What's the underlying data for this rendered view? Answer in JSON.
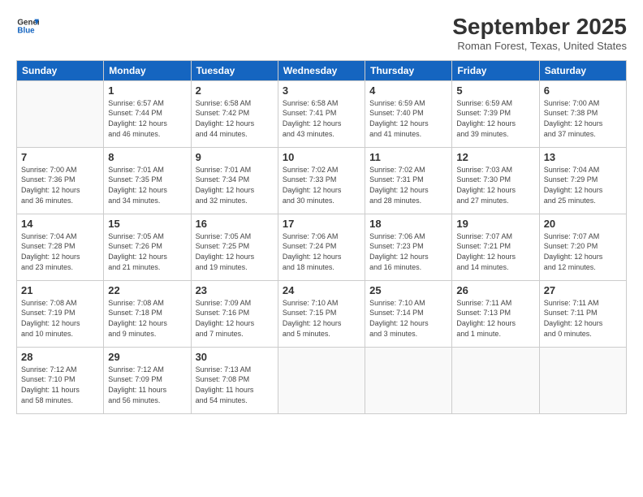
{
  "logo": {
    "line1": "General",
    "line2": "Blue"
  },
  "title": "September 2025",
  "subtitle": "Roman Forest, Texas, United States",
  "headers": [
    "Sunday",
    "Monday",
    "Tuesday",
    "Wednesday",
    "Thursday",
    "Friday",
    "Saturday"
  ],
  "weeks": [
    [
      {
        "day": "",
        "info": ""
      },
      {
        "day": "1",
        "info": "Sunrise: 6:57 AM\nSunset: 7:44 PM\nDaylight: 12 hours\nand 46 minutes."
      },
      {
        "day": "2",
        "info": "Sunrise: 6:58 AM\nSunset: 7:42 PM\nDaylight: 12 hours\nand 44 minutes."
      },
      {
        "day": "3",
        "info": "Sunrise: 6:58 AM\nSunset: 7:41 PM\nDaylight: 12 hours\nand 43 minutes."
      },
      {
        "day": "4",
        "info": "Sunrise: 6:59 AM\nSunset: 7:40 PM\nDaylight: 12 hours\nand 41 minutes."
      },
      {
        "day": "5",
        "info": "Sunrise: 6:59 AM\nSunset: 7:39 PM\nDaylight: 12 hours\nand 39 minutes."
      },
      {
        "day": "6",
        "info": "Sunrise: 7:00 AM\nSunset: 7:38 PM\nDaylight: 12 hours\nand 37 minutes."
      }
    ],
    [
      {
        "day": "7",
        "info": "Sunrise: 7:00 AM\nSunset: 7:36 PM\nDaylight: 12 hours\nand 36 minutes."
      },
      {
        "day": "8",
        "info": "Sunrise: 7:01 AM\nSunset: 7:35 PM\nDaylight: 12 hours\nand 34 minutes."
      },
      {
        "day": "9",
        "info": "Sunrise: 7:01 AM\nSunset: 7:34 PM\nDaylight: 12 hours\nand 32 minutes."
      },
      {
        "day": "10",
        "info": "Sunrise: 7:02 AM\nSunset: 7:33 PM\nDaylight: 12 hours\nand 30 minutes."
      },
      {
        "day": "11",
        "info": "Sunrise: 7:02 AM\nSunset: 7:31 PM\nDaylight: 12 hours\nand 28 minutes."
      },
      {
        "day": "12",
        "info": "Sunrise: 7:03 AM\nSunset: 7:30 PM\nDaylight: 12 hours\nand 27 minutes."
      },
      {
        "day": "13",
        "info": "Sunrise: 7:04 AM\nSunset: 7:29 PM\nDaylight: 12 hours\nand 25 minutes."
      }
    ],
    [
      {
        "day": "14",
        "info": "Sunrise: 7:04 AM\nSunset: 7:28 PM\nDaylight: 12 hours\nand 23 minutes."
      },
      {
        "day": "15",
        "info": "Sunrise: 7:05 AM\nSunset: 7:26 PM\nDaylight: 12 hours\nand 21 minutes."
      },
      {
        "day": "16",
        "info": "Sunrise: 7:05 AM\nSunset: 7:25 PM\nDaylight: 12 hours\nand 19 minutes."
      },
      {
        "day": "17",
        "info": "Sunrise: 7:06 AM\nSunset: 7:24 PM\nDaylight: 12 hours\nand 18 minutes."
      },
      {
        "day": "18",
        "info": "Sunrise: 7:06 AM\nSunset: 7:23 PM\nDaylight: 12 hours\nand 16 minutes."
      },
      {
        "day": "19",
        "info": "Sunrise: 7:07 AM\nSunset: 7:21 PM\nDaylight: 12 hours\nand 14 minutes."
      },
      {
        "day": "20",
        "info": "Sunrise: 7:07 AM\nSunset: 7:20 PM\nDaylight: 12 hours\nand 12 minutes."
      }
    ],
    [
      {
        "day": "21",
        "info": "Sunrise: 7:08 AM\nSunset: 7:19 PM\nDaylight: 12 hours\nand 10 minutes."
      },
      {
        "day": "22",
        "info": "Sunrise: 7:08 AM\nSunset: 7:18 PM\nDaylight: 12 hours\nand 9 minutes."
      },
      {
        "day": "23",
        "info": "Sunrise: 7:09 AM\nSunset: 7:16 PM\nDaylight: 12 hours\nand 7 minutes."
      },
      {
        "day": "24",
        "info": "Sunrise: 7:10 AM\nSunset: 7:15 PM\nDaylight: 12 hours\nand 5 minutes."
      },
      {
        "day": "25",
        "info": "Sunrise: 7:10 AM\nSunset: 7:14 PM\nDaylight: 12 hours\nand 3 minutes."
      },
      {
        "day": "26",
        "info": "Sunrise: 7:11 AM\nSunset: 7:13 PM\nDaylight: 12 hours\nand 1 minute."
      },
      {
        "day": "27",
        "info": "Sunrise: 7:11 AM\nSunset: 7:11 PM\nDaylight: 12 hours\nand 0 minutes."
      }
    ],
    [
      {
        "day": "28",
        "info": "Sunrise: 7:12 AM\nSunset: 7:10 PM\nDaylight: 11 hours\nand 58 minutes."
      },
      {
        "day": "29",
        "info": "Sunrise: 7:12 AM\nSunset: 7:09 PM\nDaylight: 11 hours\nand 56 minutes."
      },
      {
        "day": "30",
        "info": "Sunrise: 7:13 AM\nSunset: 7:08 PM\nDaylight: 11 hours\nand 54 minutes."
      },
      {
        "day": "",
        "info": ""
      },
      {
        "day": "",
        "info": ""
      },
      {
        "day": "",
        "info": ""
      },
      {
        "day": "",
        "info": ""
      }
    ]
  ]
}
